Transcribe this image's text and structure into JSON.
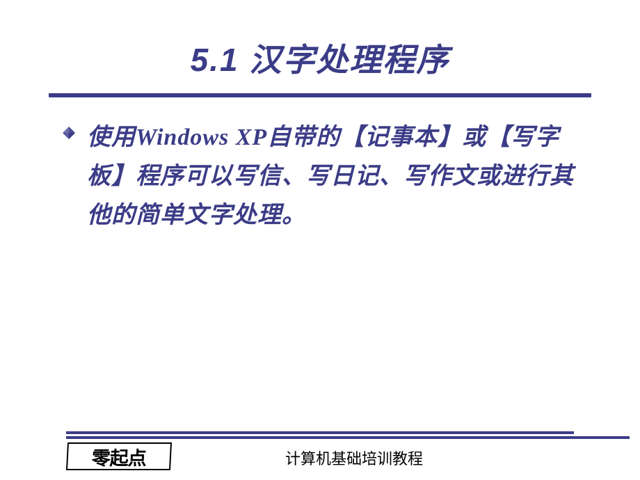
{
  "title": "5.1   汉字处理程序",
  "body_text": "使用Windows XP自带的【记事本】或【写字板】程序可以写信、写日记、写作文或进行其他的简单文字处理。",
  "logo_text": "零起点",
  "footer_text": "计算机基础培训教程"
}
